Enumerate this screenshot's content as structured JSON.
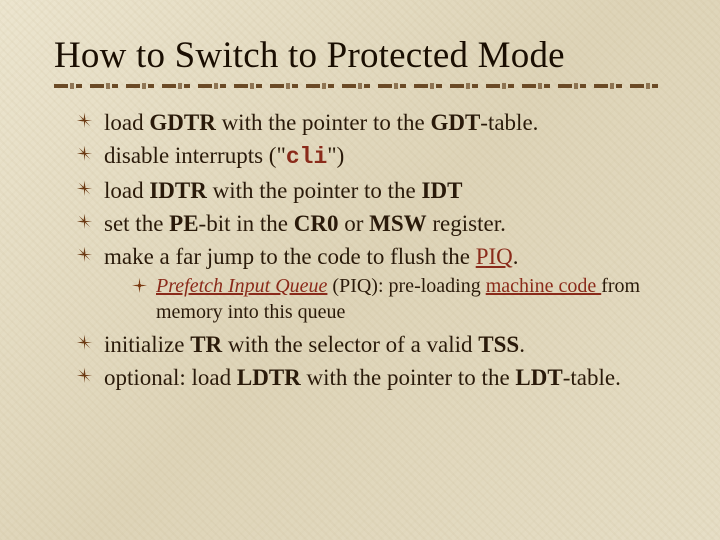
{
  "title": "How to Switch to Protected Mode",
  "items": {
    "i0": {
      "pre": "load ",
      "b1": "GDTR",
      "mid": " with the pointer to the ",
      "b2": "GDT",
      "post": "-table."
    },
    "i1": {
      "pre": "disable interrupts (\"",
      "code": "cli",
      "post": "\")"
    },
    "i2": {
      "pre": "load ",
      "b1": "IDTR",
      "mid": " with the pointer to the ",
      "b2": "IDT"
    },
    "i3": {
      "pre": "set the ",
      "b1": "PE",
      "mid1": "-bit in the ",
      "b2": "CR0",
      "mid2": " or ",
      "b3": "MSW",
      "post": " register."
    },
    "i4": {
      "pre": "make a far jump to the code to flush the ",
      "link": "PIQ",
      "post": "."
    },
    "sub0": {
      "emph": "Prefetch Input Queue",
      "roman1": " (PIQ): pre-loading ",
      "link": "machine code ",
      "roman2": "from memory into this queue"
    },
    "i5": {
      "pre": "initialize ",
      "b1": "TR",
      "mid": " with the selector of a valid ",
      "b2": "TSS",
      "post": "."
    },
    "i6": {
      "pre": "optional: load ",
      "b1": "LDTR",
      "mid": " with the pointer to the ",
      "b2": "LDT",
      "post": "-table."
    }
  }
}
